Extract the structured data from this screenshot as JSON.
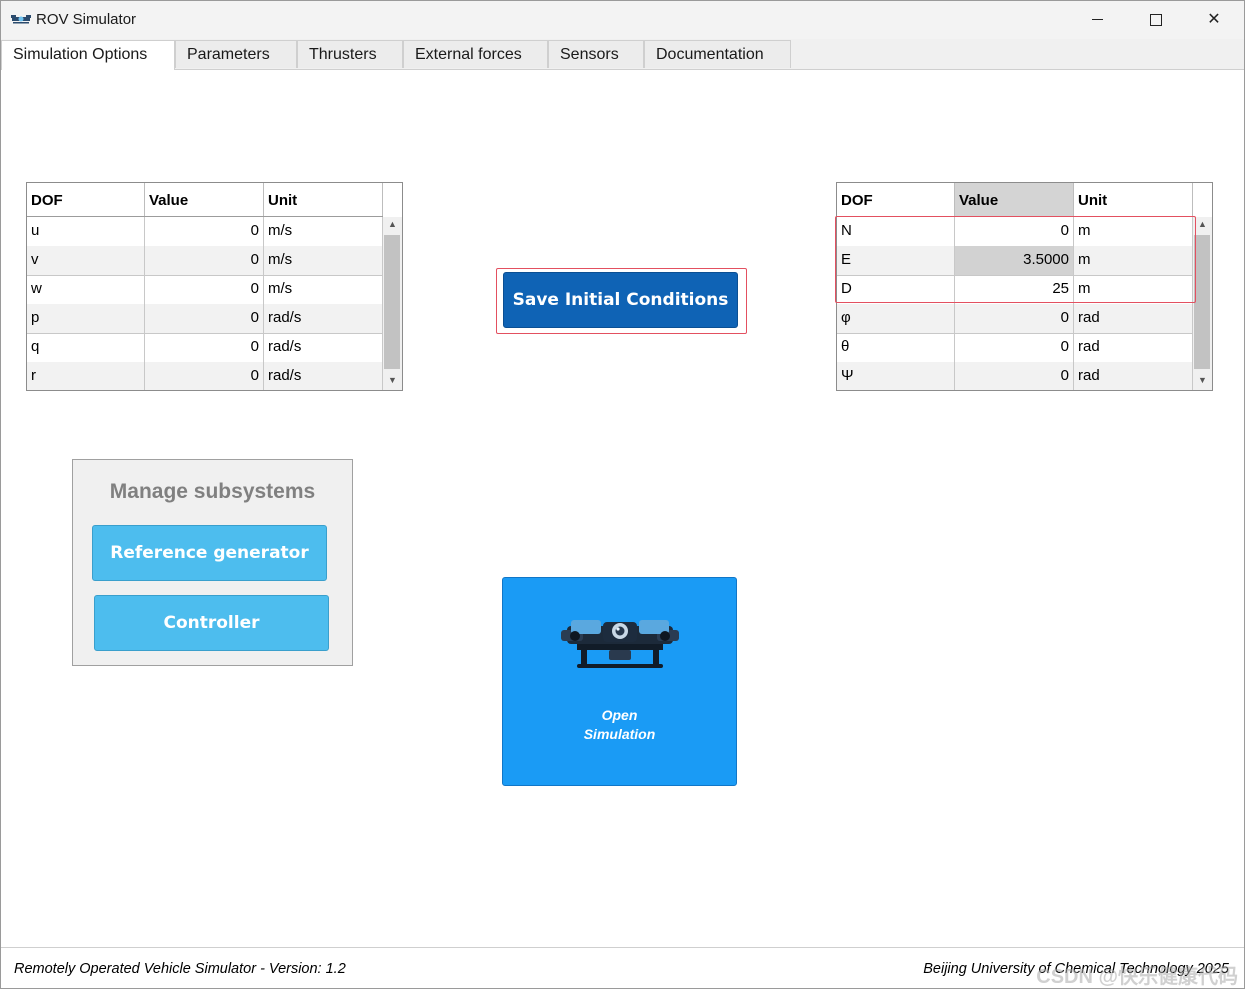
{
  "window": {
    "title": "ROV Simulator",
    "minimize": "",
    "maximize": "",
    "close": "✕"
  },
  "tabs": [
    {
      "label": "Simulation Options",
      "active": true
    },
    {
      "label": "Parameters"
    },
    {
      "label": "Thrusters"
    },
    {
      "label": "External forces"
    },
    {
      "label": "Sensors"
    },
    {
      "label": "Documentation"
    }
  ],
  "velocity_table": {
    "headers": [
      "DOF",
      "Value",
      "Unit"
    ],
    "rows": [
      {
        "dof": "u",
        "value": "0",
        "unit": "m/s"
      },
      {
        "dof": "v",
        "value": "0",
        "unit": "m/s"
      },
      {
        "dof": "w",
        "value": "0",
        "unit": "m/s"
      },
      {
        "dof": "p",
        "value": "0",
        "unit": "rad/s"
      },
      {
        "dof": "q",
        "value": "0",
        "unit": "rad/s"
      },
      {
        "dof": "r",
        "value": "0",
        "unit": "rad/s"
      }
    ]
  },
  "position_table": {
    "headers": [
      "DOF",
      "Value",
      "Unit"
    ],
    "rows": [
      {
        "dof": "N",
        "value": "0",
        "unit": "m"
      },
      {
        "dof": "E",
        "value": "3.5000",
        "unit": "m"
      },
      {
        "dof": "D",
        "value": "25",
        "unit": "m"
      },
      {
        "dof": "φ",
        "value": "0",
        "unit": "rad"
      },
      {
        "dof": "θ",
        "value": "0",
        "unit": "rad"
      },
      {
        "dof": "Ψ",
        "value": "0",
        "unit": "rad"
      }
    ]
  },
  "save_button": {
    "label": "Save Initial Conditions"
  },
  "manage_subsystems": {
    "title": "Manage subsystems",
    "reference_generator": "Reference generator",
    "controller": "Controller"
  },
  "open_simulation": {
    "line1": "Open",
    "line2": "Simulation"
  },
  "status": {
    "left": "Remotely Operated Vehicle Simulator - Version: 1.2",
    "right": "Beijing University of Chemical Technology 2025",
    "watermark": "CSDN @快乐健康代码"
  },
  "colors": {
    "save_button": "#0f63b5",
    "subsystem_buttons": "#4dbdee",
    "open_simulation": "#1a9bf5",
    "highlight_border": "#e35060"
  }
}
